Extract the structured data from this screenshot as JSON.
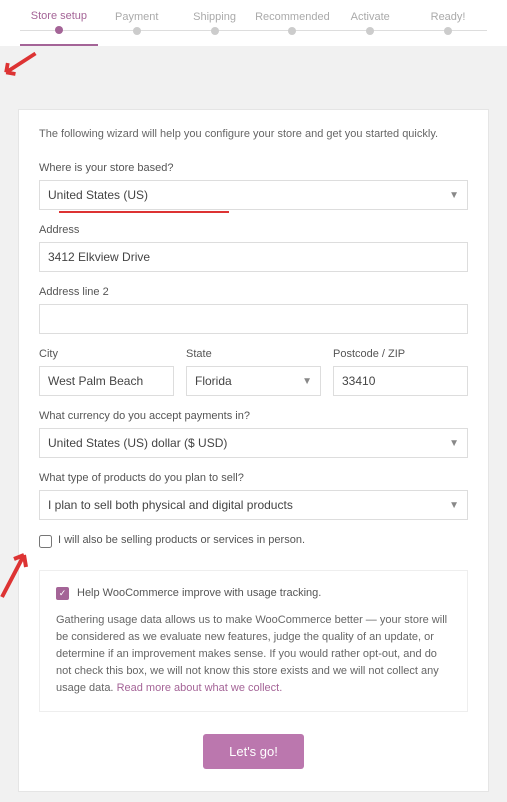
{
  "stepper": {
    "steps": [
      "Store setup",
      "Payment",
      "Shipping",
      "Recommended",
      "Activate",
      "Ready!"
    ],
    "activeIndex": 0
  },
  "intro": "The following wizard will help you configure your store and get you started quickly.",
  "fields": {
    "country_label": "Where is your store based?",
    "country_value": "United States (US)",
    "address_label": "Address",
    "address_value": "3412 Elkview Drive",
    "address2_label": "Address line 2",
    "address2_value": "",
    "city_label": "City",
    "city_value": "West Palm Beach",
    "state_label": "State",
    "state_value": "Florida",
    "zip_label": "Postcode / ZIP",
    "zip_value": "33410",
    "currency_label": "What currency do you accept payments in?",
    "currency_value": "United States (US) dollar ($ USD)",
    "product_type_label": "What type of products do you plan to sell?",
    "product_type_value": "I plan to sell both physical and digital products",
    "in_person_label": "I will also be selling products or services in person."
  },
  "tracking": {
    "heading": "Help WooCommerce improve with usage tracking.",
    "body": "Gathering usage data allows us to make WooCommerce better — your store will be considered as we evaluate new features, judge the quality of an update, or determine if an improvement makes sense. If you would rather opt-out, and do not check this box, we will not know this store exists and we will not collect any usage data. ",
    "link": "Read more about what we collect."
  },
  "button": "Let's go!"
}
